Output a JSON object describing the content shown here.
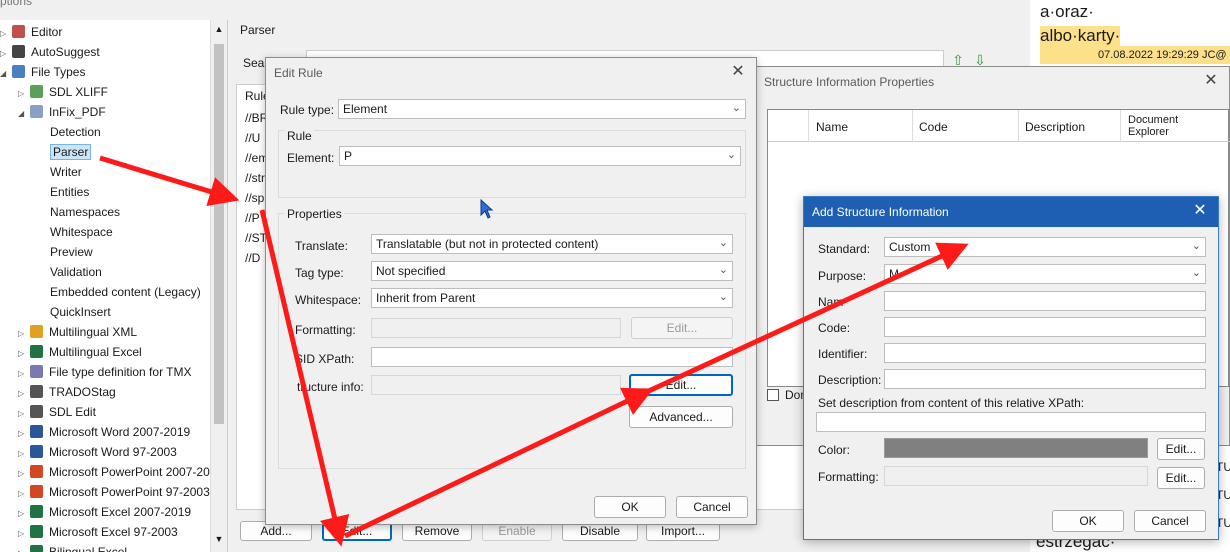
{
  "main": {
    "title_partial": "ptions",
    "parser_label": "Parser",
    "search_label": "Sear",
    "rules_label": "Rule",
    "rules": [
      "//BR",
      "//U",
      "//em",
      "//str",
      "//sp",
      "//P",
      "//ST",
      "//D"
    ],
    "bottom_buttons": [
      "Add...",
      "Edit...",
      "Remove",
      "Enable",
      "Disable",
      "Import..."
    ]
  },
  "tree": {
    "items": [
      {
        "label": "Editor",
        "level": 0,
        "exp": "▷",
        "icon": "pencil-icon",
        "color": "#c0504d"
      },
      {
        "label": "AutoSuggest",
        "level": 0,
        "exp": "▷",
        "icon": "autosuggest-icon",
        "color": "#444"
      },
      {
        "label": "File Types",
        "level": 0,
        "exp": "◢",
        "icon": "gear-icon",
        "color": "#4a7fc0"
      },
      {
        "label": "SDL XLIFF",
        "level": 1,
        "exp": "▷",
        "icon": "document-icon",
        "color": "#5aa05a"
      },
      {
        "label": "InFix_PDF",
        "level": 1,
        "exp": "◢",
        "icon": "code-icon",
        "color": "#8aa0c0"
      },
      {
        "label": "Detection",
        "level": 2,
        "exp": "",
        "icon": "",
        "color": ""
      },
      {
        "label": "Parser",
        "level": 2,
        "exp": "",
        "icon": "",
        "color": "",
        "selected": true
      },
      {
        "label": "Writer",
        "level": 2,
        "exp": "",
        "icon": "",
        "color": ""
      },
      {
        "label": "Entities",
        "level": 2,
        "exp": "",
        "icon": "",
        "color": ""
      },
      {
        "label": "Namespaces",
        "level": 2,
        "exp": "",
        "icon": "",
        "color": ""
      },
      {
        "label": "Whitespace",
        "level": 2,
        "exp": "",
        "icon": "",
        "color": ""
      },
      {
        "label": "Preview",
        "level": 2,
        "exp": "",
        "icon": "",
        "color": ""
      },
      {
        "label": "Validation",
        "level": 2,
        "exp": "",
        "icon": "",
        "color": ""
      },
      {
        "label": "Embedded content (Legacy)",
        "level": 2,
        "exp": "",
        "icon": "",
        "color": ""
      },
      {
        "label": "QuickInsert",
        "level": 2,
        "exp": "",
        "icon": "",
        "color": ""
      },
      {
        "label": "Multilingual XML",
        "level": 1,
        "exp": "▷",
        "icon": "xml-icon",
        "color": "#e0a020"
      },
      {
        "label": "Multilingual Excel",
        "level": 1,
        "exp": "▷",
        "icon": "excel-icon",
        "color": "#217346"
      },
      {
        "label": "File type definition for TMX",
        "level": 1,
        "exp": "▷",
        "icon": "tmx-icon",
        "color": "#7a7ab0"
      },
      {
        "label": "TRADOStag",
        "level": 1,
        "exp": "▷",
        "icon": "tradostag-icon",
        "color": "#555"
      },
      {
        "label": "SDL Edit",
        "level": 1,
        "exp": "▷",
        "icon": "sdl-edit-icon",
        "color": "#555"
      },
      {
        "label": "Microsoft Word 2007-2019",
        "level": 1,
        "exp": "▷",
        "icon": "word-icon",
        "color": "#2b579a"
      },
      {
        "label": "Microsoft Word 97-2003",
        "level": 1,
        "exp": "▷",
        "icon": "word-icon",
        "color": "#2b579a"
      },
      {
        "label": "Microsoft PowerPoint 2007-20",
        "level": 1,
        "exp": "▷",
        "icon": "powerpoint-icon",
        "color": "#d24726"
      },
      {
        "label": "Microsoft PowerPoint 97-2003",
        "level": 1,
        "exp": "▷",
        "icon": "powerpoint-icon",
        "color": "#d24726"
      },
      {
        "label": "Microsoft Excel 2007-2019",
        "level": 1,
        "exp": "▷",
        "icon": "excel-icon",
        "color": "#217346"
      },
      {
        "label": "Microsoft Excel 97-2003",
        "level": 1,
        "exp": "▷",
        "icon": "excel-icon",
        "color": "#217346"
      },
      {
        "label": "Bilingual Excel",
        "level": 1,
        "exp": "▷",
        "icon": "excel-icon",
        "color": "#217346"
      }
    ]
  },
  "edit_rule": {
    "title": "Edit Rule",
    "rule_type_label": "Rule type:",
    "rule_type_value": "Element",
    "rule_group": "Rule",
    "element_label": "Element:",
    "element_value": "P",
    "properties_group": "Properties",
    "translate_label": "Translate:",
    "translate_value": "Translatable (but not in protected content)",
    "tag_type_label": "Tag type:",
    "tag_type_value": "Not specified",
    "whitespace_label": "Whitespace:",
    "whitespace_value": "Inherit from Parent",
    "formatting_label": "Formatting:",
    "formatting_edit": "Edit...",
    "sid_label": "SID XPath:",
    "structure_label": "tructure info:",
    "structure_edit": "Edit...",
    "advanced": "Advanced...",
    "ok": "OK",
    "cancel": "Cancel"
  },
  "sip": {
    "title": "Structure Information Properties",
    "columns": [
      "Name",
      "Code",
      "Description",
      "Document Explorer"
    ],
    "checkbox_partial": "Don"
  },
  "asi": {
    "title": "Add Structure Information",
    "standard_label": "Standard:",
    "standard_value": "Custom",
    "purpose_label": "Purpose:",
    "purpose_value": "M",
    "name_label": "Nam",
    "code_label": "Code:",
    "identifier_label": "Identifier:",
    "description_label": "Description:",
    "xpath_label": "Set description from content of this relative XPath:",
    "color_label": "Color:",
    "color_value": "#808080",
    "color_edit": "Edit...",
    "formatting_label": "Formatting:",
    "formatting_edit": "Edit...",
    "ok": "OK",
    "cancel": "Cancel"
  },
  "background_doc": {
    "line1": "a·oraz·",
    "line2": "albo·karty·",
    "timestamp": "07.08.2022 19:29:29  JC@",
    "frag1": "TU-",
    "frag2": "TU-",
    "frag3": "TU-",
    "bottom": "estrzegac·"
  }
}
